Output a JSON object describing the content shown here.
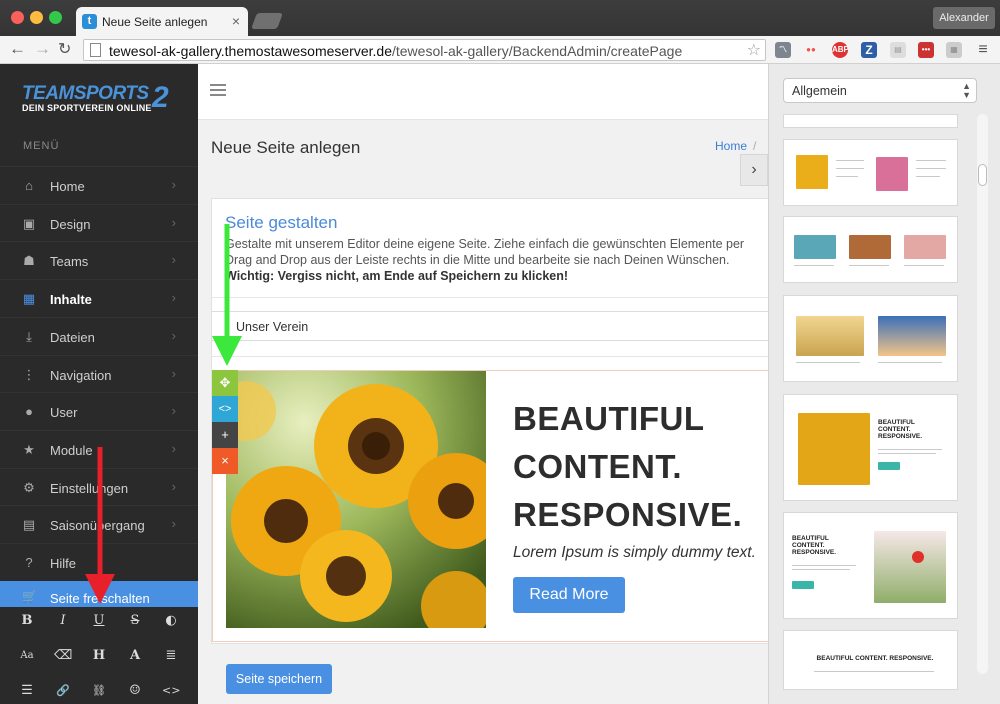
{
  "browser": {
    "tab_title": "Neue Seite anlegen",
    "tab_favicon": "t",
    "user_button": "Alexander",
    "url_prefix": "tewesol-ak-gallery.themostawesomeserver.de",
    "url_path": "/tewesol-ak-gallery/BackendAdmin/createPage",
    "extensions": [
      "chart-icon",
      "dots-icon",
      "ABP",
      "Z",
      "doc-icon",
      "more-icon",
      "grid-icon",
      "menu-icon"
    ]
  },
  "sidebar": {
    "logo_line1": "TEAMSPORTS",
    "logo_line2": "DEIN SPORTVEREIN ONLINE",
    "logo_num": "2",
    "menu_heading": "MENÜ",
    "items": [
      {
        "label": "Home",
        "icon": "home-icon"
      },
      {
        "label": "Design",
        "icon": "image-icon"
      },
      {
        "label": "Teams",
        "icon": "users-icon"
      },
      {
        "label": "Inhalte",
        "icon": "content-icon"
      },
      {
        "label": "Dateien",
        "icon": "download-icon"
      },
      {
        "label": "Navigation",
        "icon": "navigation-icon"
      },
      {
        "label": "User",
        "icon": "user-icon"
      },
      {
        "label": "Module",
        "icon": "star-icon"
      },
      {
        "label": "Einstellungen",
        "icon": "cogs-icon"
      },
      {
        "label": "Saisonübergang",
        "icon": "calendar-icon"
      },
      {
        "label": "Hilfe",
        "icon": "help-icon"
      }
    ],
    "publish_label": "Seite freischalten",
    "format_buttons": [
      "B",
      "I",
      "U",
      "S",
      "◐",
      "Aa",
      "⌫",
      "H",
      "A",
      "≣",
      "☰",
      "🔗",
      "⛓",
      "☺",
      "<>"
    ]
  },
  "main": {
    "page_title": "Neue Seite anlegen",
    "breadcrumb_home": "Home",
    "breadcrumb_sep": "/",
    "card_title": "Seite gestalten",
    "card_desc": "Gestalte mit unserem Editor deine eigene Seite. Ziehe einfach die gewünschten Elemente per Drag and Drop aus der Leiste rechts in die Mitte und bearbeite sie nach Deinen Wünschen.",
    "card_warning": "Wichtig: Vergiss nicht, am Ende auf Speichern zu klicken!",
    "page_name_value": "Unser Verein",
    "block_heading": [
      "BEAUTIFUL",
      "CONTENT.",
      "RESPONSIVE."
    ],
    "block_lorem": "Lorem Ipsum is simply dummy text.",
    "block_button": "Read More",
    "save_button": "Seite speichern",
    "block_controls": [
      {
        "name": "move-icon",
        "glyph": "✥",
        "color": "#8cc63f"
      },
      {
        "name": "code-icon",
        "glyph": "<>",
        "color": "#2ea6d6"
      },
      {
        "name": "add-icon",
        "glyph": "+",
        "color": "#444444"
      },
      {
        "name": "delete-icon",
        "glyph": "×",
        "color": "#f05a28"
      }
    ]
  },
  "right_panel": {
    "category": "Allgemein",
    "template_titles": [
      "BEAUTIFUL CONTENT. RESPONSIVE.",
      "BEAUTIFUL CONTENT. RESPONSIVE.",
      "BEAUTIFUL CONTENT. RESPONSIVE."
    ]
  },
  "colors": {
    "accent": "#4a90e2",
    "sidebar_bg": "#2a2a2a",
    "green_arrow": "#3be83b",
    "red_arrow": "#e8202a"
  }
}
